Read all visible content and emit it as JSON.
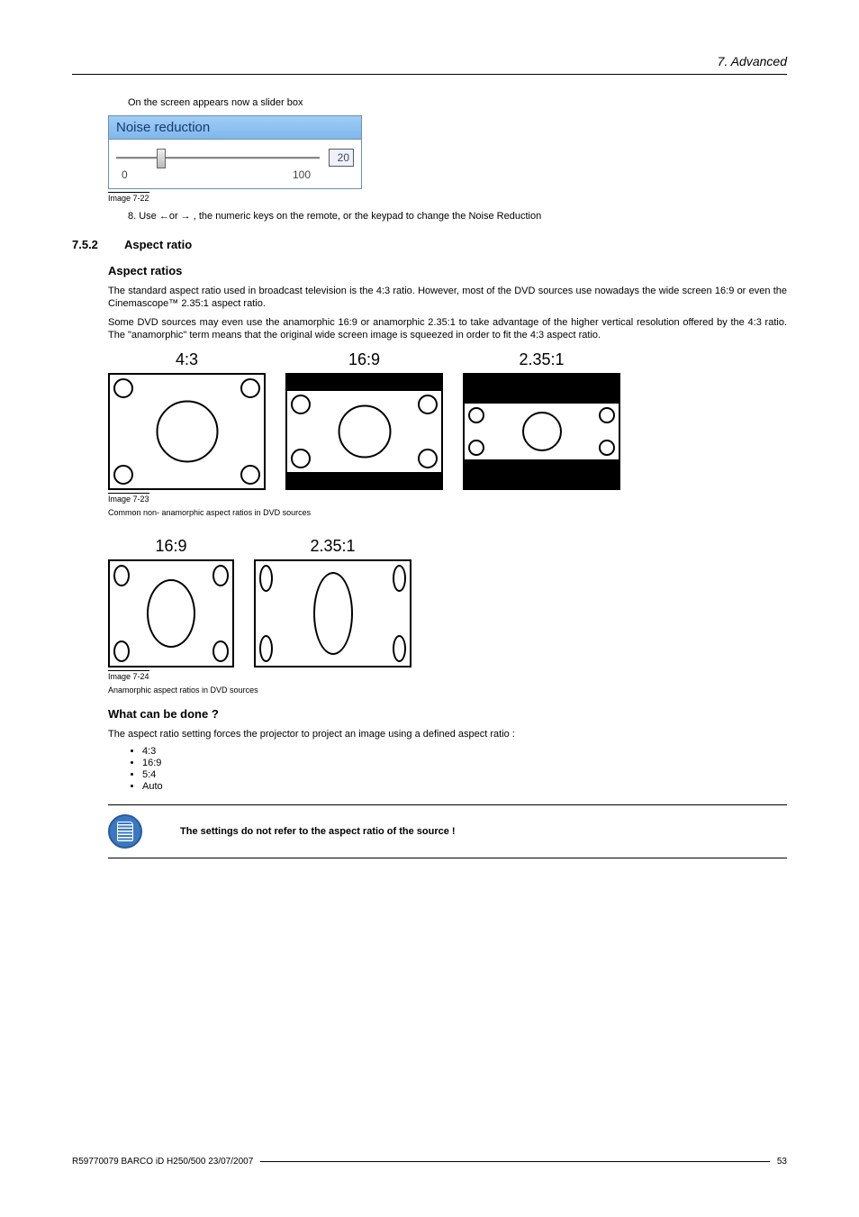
{
  "header": {
    "chapter": "7. Advanced"
  },
  "intro": "On the screen appears now a slider box",
  "slider": {
    "title": "Noise reduction",
    "min": "0",
    "max": "100",
    "value": "20",
    "caption": "Image 7-22"
  },
  "step8": "8.  Use ←or → , the numeric keys on the remote, or the keypad to change the Noise Reduction",
  "section": {
    "num": "7.5.2",
    "title": "Aspect ratio"
  },
  "block1": {
    "heading": "Aspect ratios",
    "p1": "The standard aspect ratio used in broadcast television is the 4:3 ratio. However, most of the DVD sources use nowadays the wide screen 16:9 or even the Cinemascope™ 2.35:1 aspect ratio.",
    "p2": "Some DVD sources may even use the anamorphic 16:9 or anamorphic 2.35:1 to take advantage of the higher vertical resolution offered by the 4:3 ratio. The \"anamorphic\" term means that the original wide screen image is squeezed in order to fit the 4:3 aspect ratio."
  },
  "fig23": {
    "labels": [
      "4:3",
      "16:9",
      "2.35:1"
    ],
    "caption": "Image 7-23",
    "desc": "Common non- anamorphic aspect ratios in DVD sources"
  },
  "fig24": {
    "labels": [
      "16:9",
      "2.35:1"
    ],
    "caption": "Image 7-24",
    "desc": "Anamorphic aspect ratios in DVD sources"
  },
  "block2": {
    "heading": "What can be done ?",
    "p1": "The aspect ratio setting forces the projector to project an image using a defined aspect ratio :",
    "items": [
      "4:3",
      "16:9",
      "5:4",
      "Auto"
    ]
  },
  "note": "The settings do not refer to the aspect ratio of the source !",
  "footer": {
    "left": "R59770079  BARCO iD H250/500  23/07/2007",
    "right": "53"
  }
}
